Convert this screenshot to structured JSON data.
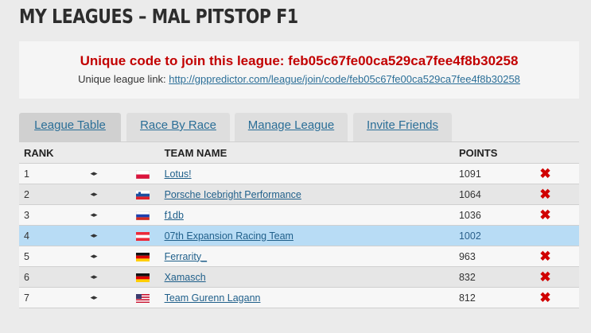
{
  "page": {
    "title": "MY LEAGUES – MAL PITSTOP F1"
  },
  "league": {
    "code_text": "Unique code to join this league: feb05c67fe00ca529ca7fee4f8b30258",
    "link_label": "Unique league link:",
    "link_url": "http://gppredictor.com/league/join/code/feb05c67fe00ca529ca7fee4f8b30258"
  },
  "tabs": [
    {
      "label": "League Table",
      "active": true
    },
    {
      "label": "Race By Race",
      "active": false
    },
    {
      "label": "Manage League",
      "active": false
    },
    {
      "label": "Invite Friends",
      "active": false
    }
  ],
  "table": {
    "headers": {
      "rank": "RANK",
      "team": "TEAM NAME",
      "points": "POINTS"
    },
    "rows": [
      {
        "rank": "1",
        "flag": "poland-flag",
        "team": "Lotus!",
        "points": "1091",
        "delete": true
      },
      {
        "rank": "2",
        "flag": "slovenia-flag",
        "team": "Porsche Icebright Performance",
        "points": "1064",
        "delete": true
      },
      {
        "rank": "3",
        "flag": "russia-flag",
        "team": "f1db",
        "points": "1036",
        "delete": true
      },
      {
        "rank": "4",
        "flag": "austria-flag",
        "team": "07th Expansion Racing Team",
        "points": "1002",
        "delete": false
      },
      {
        "rank": "5",
        "flag": "germany-flag",
        "team": "Ferrarity_",
        "points": "963",
        "delete": true
      },
      {
        "rank": "6",
        "flag": "germany-flag",
        "team": "Xamasch",
        "points": "832",
        "delete": true
      },
      {
        "rank": "7",
        "flag": "usa-flag",
        "team": "Team Gurenn Lagann",
        "points": "812",
        "delete": true
      }
    ]
  },
  "colors": {
    "code_red": "#c20000",
    "link_blue": "#2a6e97",
    "highlight_row": "#b8dcf5",
    "delete_red": "#d00000"
  }
}
